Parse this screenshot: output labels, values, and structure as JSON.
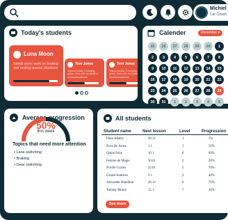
{
  "user": {
    "name": "Michiel",
    "role": "Car Coach"
  },
  "students_card": {
    "title": "Today's students",
    "students": [
      {
        "name": "Luna Moon",
        "desc": "Needs some work on braking and routing special situations",
        "progress": 0.82
      },
      {
        "name": "Tom Jones",
        "desc": "Topic of today: Changing gears, lines with no positive recommendations",
        "progress": 0.55
      },
      {
        "name": "Tom Jones",
        "desc": "Topic of today: Changing gears, lines with no positive recommendations",
        "progress": 0.55
      }
    ],
    "page_count": 3,
    "active_page": 0
  },
  "calendar": {
    "title": "Calender",
    "month_selector": "December",
    "weeks": [
      [
        {
          "d": "25",
          "s": "other"
        },
        {
          "d": "26",
          "s": "other"
        },
        {
          "d": "27",
          "s": "other"
        },
        {
          "d": "28",
          "s": "other"
        },
        {
          "d": "29",
          "s": "other"
        },
        {
          "d": "30",
          "s": "other"
        },
        {
          "d": "1",
          "s": "cur"
        }
      ],
      [
        {
          "d": "2",
          "s": "cur"
        },
        {
          "d": "3",
          "s": "cur"
        },
        {
          "d": "4",
          "s": "cur"
        },
        {
          "d": "5",
          "s": "cur"
        },
        {
          "d": "6",
          "s": "cur"
        },
        {
          "d": "7",
          "s": "cur"
        },
        {
          "d": "8",
          "s": "cur"
        }
      ],
      [
        {
          "d": "9",
          "s": "cur"
        },
        {
          "d": "10",
          "s": "cur"
        },
        {
          "d": "11",
          "s": "cur"
        },
        {
          "d": "12",
          "s": "cur"
        },
        {
          "d": "13",
          "s": "cur"
        },
        {
          "d": "14",
          "s": "cur"
        },
        {
          "d": "15",
          "s": "cur"
        }
      ],
      [
        {
          "d": "16",
          "s": "cur"
        },
        {
          "d": "17",
          "s": "cur"
        },
        {
          "d": "18",
          "s": "cur"
        },
        {
          "d": "19",
          "s": "cur"
        },
        {
          "d": "20",
          "s": "cur"
        },
        {
          "d": "21",
          "s": "cur"
        },
        {
          "d": "22",
          "s": "cur"
        }
      ],
      [
        {
          "d": "23",
          "s": "cur"
        },
        {
          "d": "24",
          "s": "cur"
        },
        {
          "d": "25",
          "s": "cur"
        },
        {
          "d": "26",
          "s": "cur"
        },
        {
          "d": "27",
          "s": "cur"
        },
        {
          "d": "28",
          "s": "cur"
        },
        {
          "d": "29",
          "s": "today"
        }
      ],
      [
        {
          "d": "30",
          "s": "cur"
        },
        {
          "d": "31",
          "s": "cur"
        },
        {
          "d": "1",
          "s": "other"
        },
        {
          "d": "2",
          "s": "other"
        },
        {
          "d": "3",
          "s": "other"
        },
        {
          "d": "4",
          "s": "other"
        },
        {
          "d": "5",
          "s": "other"
        }
      ]
    ]
  },
  "progression": {
    "title": "Average progression",
    "value_label": "50%",
    "value": 0.5,
    "period": "this week",
    "attention_title": "Topics that need more attention",
    "topics": [
      "Lane switching",
      "Braking",
      "Gear switching"
    ]
  },
  "all_students": {
    "title": "All students",
    "columns": [
      "Student name",
      "Next lesson",
      "Level",
      "Progression"
    ],
    "rows": [
      [
        "Fleur Adams",
        "30.11",
        "1",
        "5%"
      ],
      [
        "Nora De Arnes",
        "1.1",
        "5",
        "50%"
      ],
      [
        "Quinn Fitze",
        "10.1",
        "6",
        "80%"
      ],
      [
        "Femme de Magie",
        "30.01",
        "2",
        "20%"
      ],
      [
        "Nordie Graves",
        "22.01",
        "5",
        "70%"
      ],
      [
        "Gerald Andrews",
        "9.1",
        "3",
        "40%"
      ],
      [
        "Alexander Hamilton",
        "20.12",
        "6",
        "70%"
      ],
      [
        "Tommy Moore",
        "15.1",
        "7",
        "30%"
      ]
    ],
    "see_more": "See more"
  },
  "colors": {
    "background": "#0f2c36",
    "accent": "#e8553f",
    "card": "#ffffff",
    "calendar_muted": "#bcd3d0"
  },
  "icons": [
    "search-icon",
    "moon-icon",
    "bell-icon",
    "gear-icon",
    "students-icon",
    "calendar-icon",
    "progression-icon",
    "all-students-icon",
    "chevron-down-icon"
  ]
}
